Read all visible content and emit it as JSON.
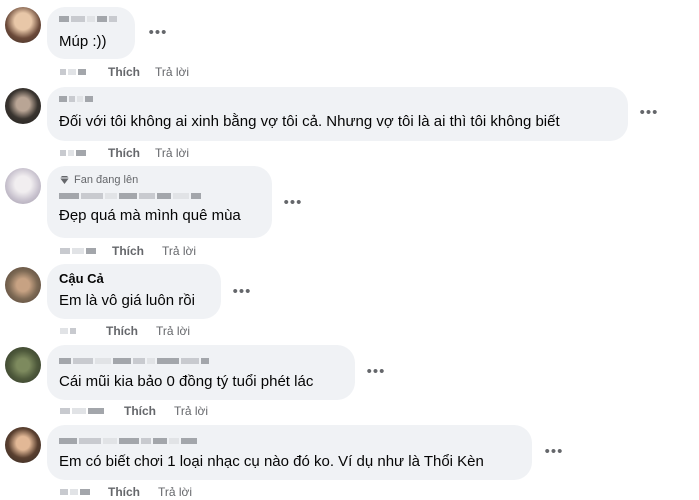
{
  "actions": {
    "like": "Thích",
    "reply": "Trả lời"
  },
  "comments": [
    {
      "name": "",
      "text": "Múp :))"
    },
    {
      "name": "",
      "text": "Đối với tôi không ai xinh bằng vợ tôi cả. Nhưng vợ tôi là ai thì tôi không biết"
    },
    {
      "name": "",
      "badge": "Fan đang lên",
      "text": "Đẹp quá mà mình quê mùa"
    },
    {
      "name": "Cậu Cả",
      "text": "Em là vô giá luôn rồi"
    },
    {
      "name": "",
      "text": "Cái mũi kia bảo 0 đồng tý tuổi phét lác"
    },
    {
      "name": "",
      "text": "Em có biết chơi 1 loại nhạc cụ nào đó ko. Ví dụ như là Thổi Kèn"
    }
  ],
  "icons": {
    "more": "more-dots-icon",
    "badge": "diamond-badge-icon"
  },
  "colors": {
    "bubble": "#f0f2f5",
    "secondary_text": "#65676b",
    "text": "#050505"
  }
}
